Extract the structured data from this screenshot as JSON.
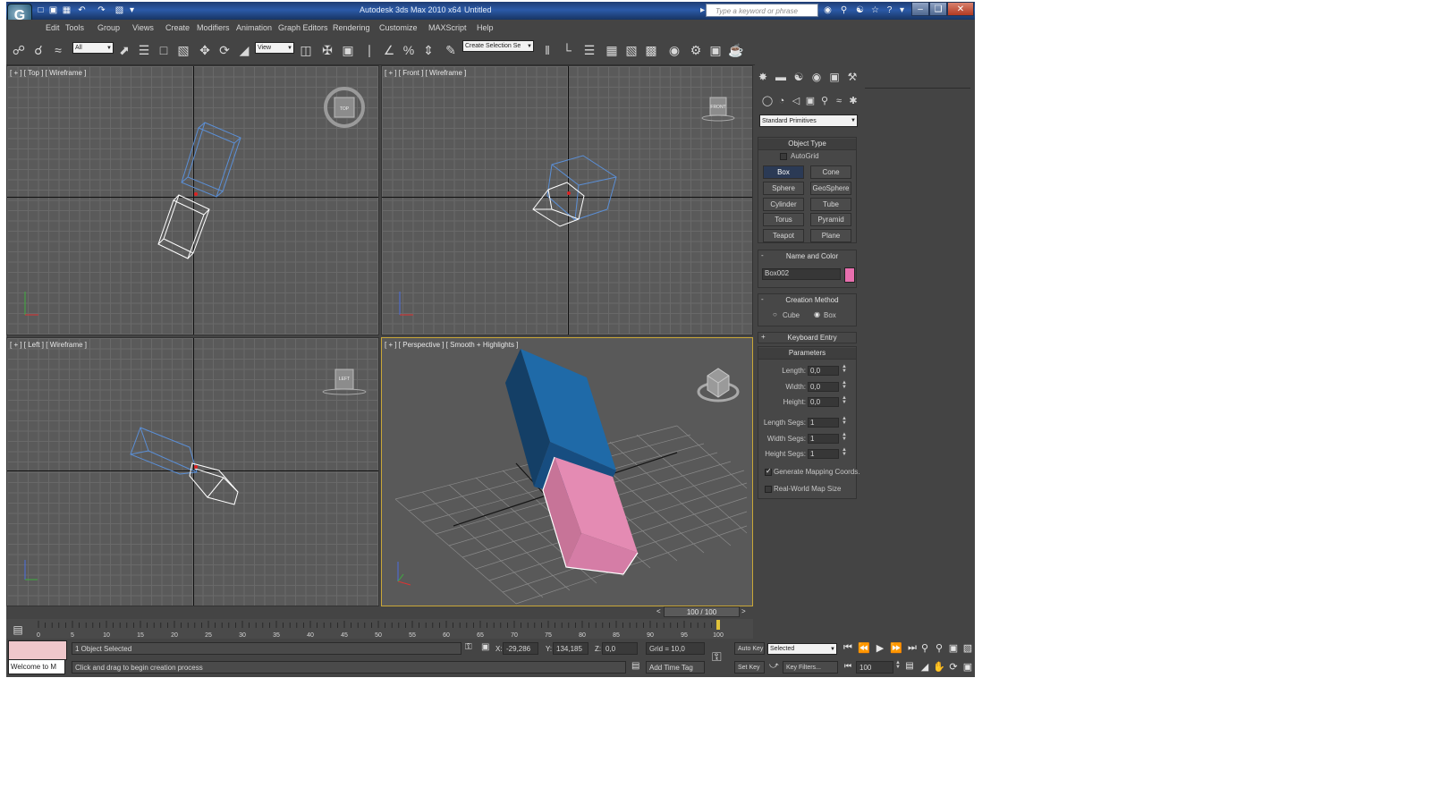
{
  "title_bar": {
    "app_title": "Autodesk 3ds Max  2010 x64",
    "doc_title": "Untitled",
    "search_placeholder": "Type a keyword or phrase",
    "logo_glyph": "G"
  },
  "menu": [
    "Edit",
    "Tools",
    "Group",
    "Views",
    "Create",
    "Modifiers",
    "Animation",
    "Graph Editors",
    "Rendering",
    "Customize",
    "MAXScript",
    "Help"
  ],
  "toolbar": {
    "selection_filter": "All",
    "reference_coord": "View",
    "named_selection": "Create Selection Se"
  },
  "viewports": {
    "top_label": "[ + ] [ Top ] [ Wireframe ]",
    "front_label": "[ + ] [ Front ] [ Wireframe ]",
    "left_label": "[ + ] [ Left ] [ Wireframe ]",
    "persp_label": "[ + ] [ Perspective ] [ Smooth + Highlights ]",
    "cube_top": "TOP",
    "cube_front": "FRONT",
    "cube_left": "LEFT"
  },
  "command_panel": {
    "category": "Standard Primitives",
    "object_type": {
      "title": "Object Type",
      "autogrid": "AutoGrid",
      "buttons": [
        "Box",
        "Cone",
        "Sphere",
        "GeoSphere",
        "Cylinder",
        "Tube",
        "Torus",
        "Pyramid",
        "Teapot",
        "Plane"
      ]
    },
    "name_color": {
      "title": "Name and Color",
      "name": "Box002",
      "swatch": "#e86fae"
    },
    "creation_method": {
      "title": "Creation Method",
      "cube": "Cube",
      "box": "Box"
    },
    "keyboard_entry": {
      "title": "Keyboard Entry",
      "expander": "+",
      "collapse": "-"
    },
    "parameters": {
      "title": "Parameters",
      "fields": [
        {
          "label": "Length:",
          "value": "0,0"
        },
        {
          "label": "Width:",
          "value": "0,0"
        },
        {
          "label": "Height:",
          "value": "0,0"
        },
        {
          "label": "Length Segs:",
          "value": "1"
        },
        {
          "label": "Width Segs:",
          "value": "1"
        },
        {
          "label": "Height Segs:",
          "value": "1"
        }
      ],
      "gen_mapping": "Generate Mapping Coords.",
      "real_world": "Real-World Map Size"
    }
  },
  "timeline": {
    "frame_display": "100 / 100",
    "ticks": [
      "0",
      "5",
      "10",
      "15",
      "20",
      "25",
      "30",
      "35",
      "40",
      "45",
      "50",
      "55",
      "60",
      "65",
      "70",
      "75",
      "80",
      "85",
      "90",
      "95",
      "100"
    ],
    "slider_fraction": 1.0
  },
  "status": {
    "welcome": "Welcome to M",
    "objects_selected": "1 Object Selected",
    "prompt": "Click and drag to begin creation process",
    "x_label": "X:",
    "x_value": "-29,286",
    "y_label": "Y:",
    "y_value": "134,185",
    "z_label": "Z:",
    "z_value": "0,0",
    "grid": "Grid = 10,0",
    "add_time_tag": "Add Time Tag",
    "auto_key": "Auto Key",
    "set_key": "Set Key",
    "selected_dropdown": "Selected",
    "key_filters": "Key Filters...",
    "current_frame": "100"
  },
  "colors": {
    "box_blue": "#1f6aa8",
    "box_pink": "#e48bb3",
    "viewport_bg": "#5a5a5a",
    "active_border": "#c9a739"
  }
}
